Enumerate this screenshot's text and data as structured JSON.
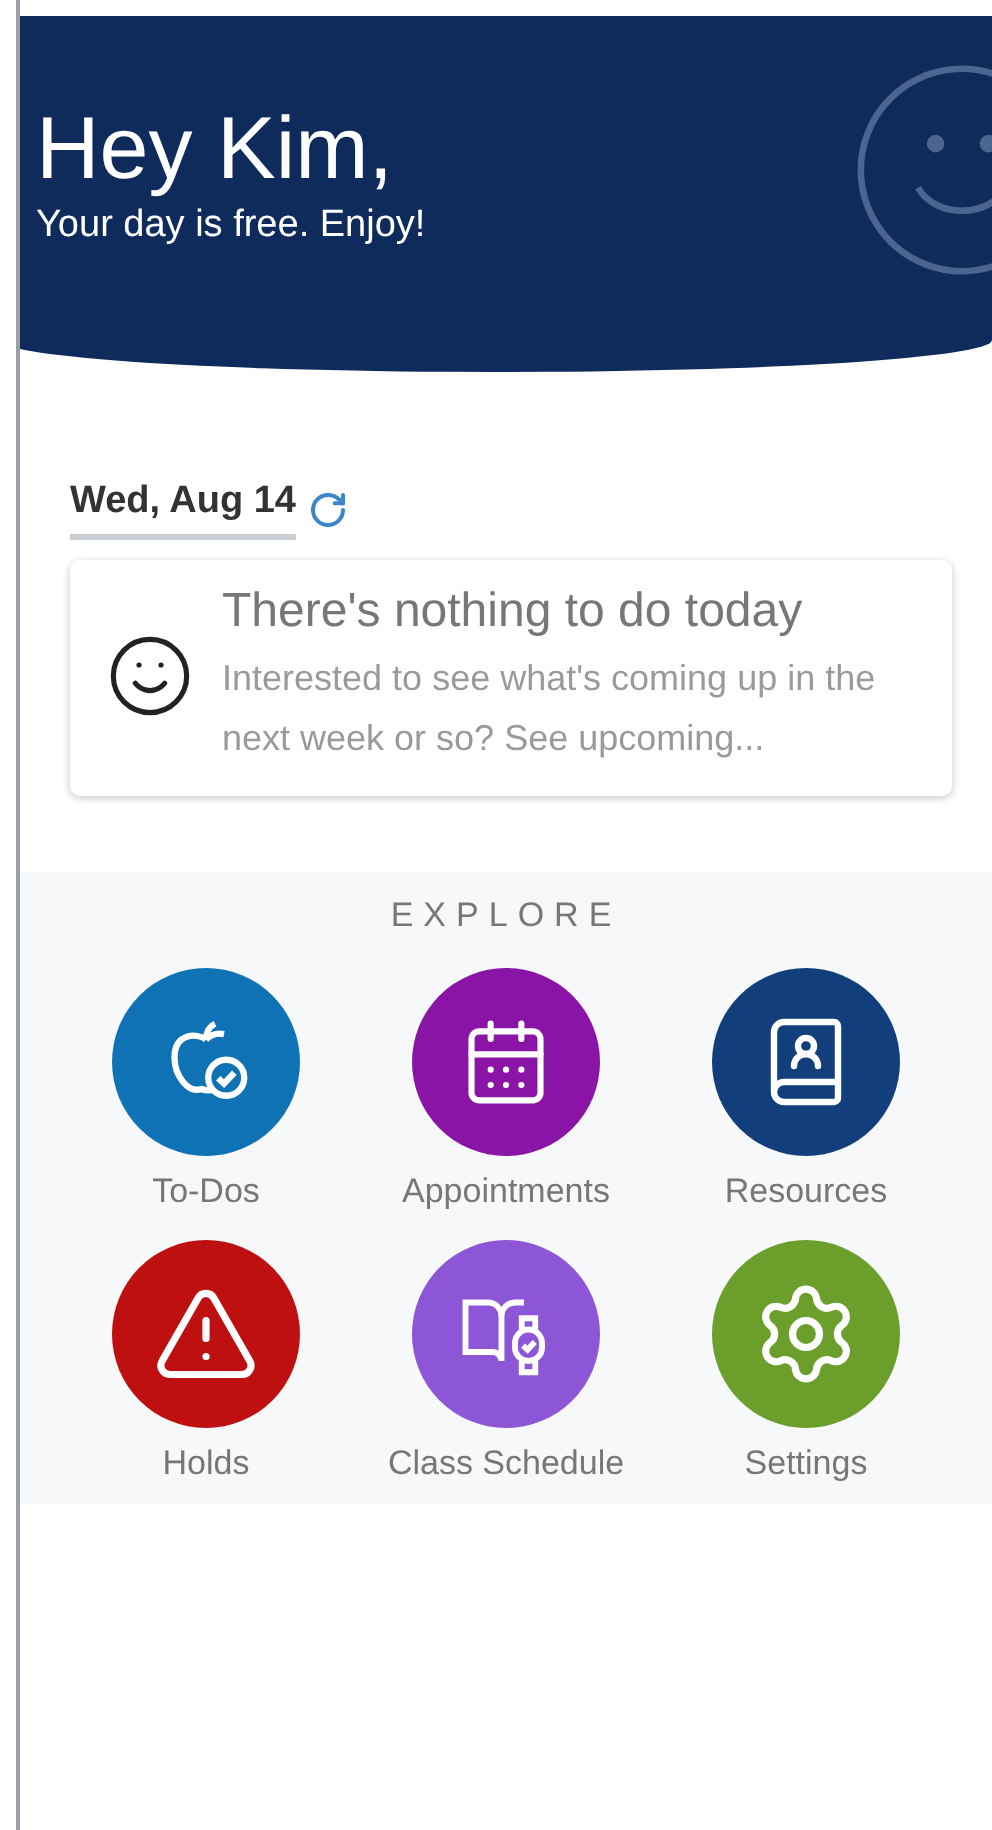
{
  "header": {
    "greeting": "Hey Kim,",
    "subtitle": "Your day is free. Enjoy!"
  },
  "date": {
    "label": "Wed, Aug 14"
  },
  "empty_card": {
    "title": "There's nothing to do today",
    "message": "Interested to see what's coming up in the next week or so? See upcoming..."
  },
  "explore": {
    "heading": "EXPLORE",
    "tiles": [
      {
        "label": "To-Dos",
        "kind": "todo",
        "color": "#0f72b4"
      },
      {
        "label": "Appointments",
        "kind": "calendar",
        "color": "#8a14a6"
      },
      {
        "label": "Resources",
        "kind": "contacts",
        "color": "#123e7c"
      },
      {
        "label": "Holds",
        "kind": "alert",
        "color": "#be1010"
      },
      {
        "label": "Class Schedule",
        "kind": "schedule",
        "color": "#8c56d6"
      },
      {
        "label": "Settings",
        "kind": "settings",
        "color": "#6c9e2c"
      }
    ]
  }
}
